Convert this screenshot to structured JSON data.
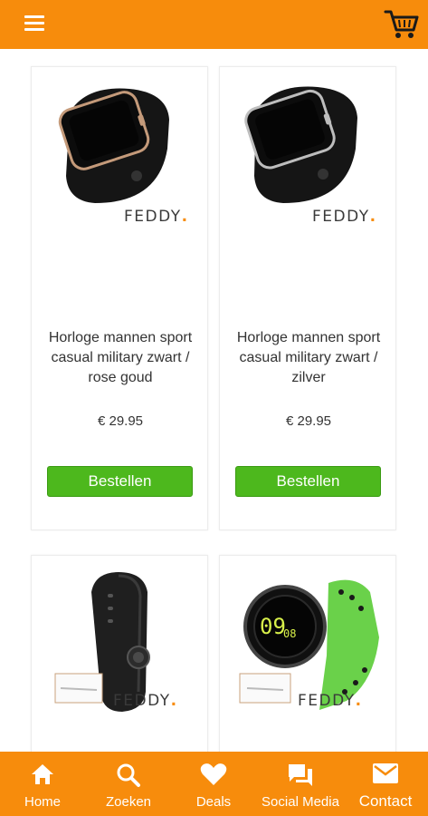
{
  "header": {
    "menu_icon": "hamburger-menu-icon",
    "cart_icon": "shopping-cart-icon",
    "color": "#f78c0c"
  },
  "products": [
    {
      "title": "Horloge mannen sport casual military zwart / rose goud",
      "price": "€ 29.95",
      "button": "Bestellen",
      "brand_logo": "FEDDY."
    },
    {
      "title": "Horloge mannen sport casual military zwart / zilver",
      "price": "€ 29.95",
      "button": "Bestellen",
      "brand_logo": "FEDDY."
    },
    {
      "brand_logo": "FEDDY."
    },
    {
      "brand_logo": "FEDDY."
    }
  ],
  "nav": {
    "items": [
      {
        "label": "Home",
        "icon": "home-icon"
      },
      {
        "label": "Zoeken",
        "icon": "search-icon"
      },
      {
        "label": "Deals",
        "icon": "heart-icon"
      },
      {
        "label": "Social Media",
        "icon": "chat-icon"
      },
      {
        "label": "Contact",
        "icon": "mail-icon"
      }
    ]
  },
  "colors": {
    "accent": "#f78c0c",
    "button": "#4db81d"
  }
}
